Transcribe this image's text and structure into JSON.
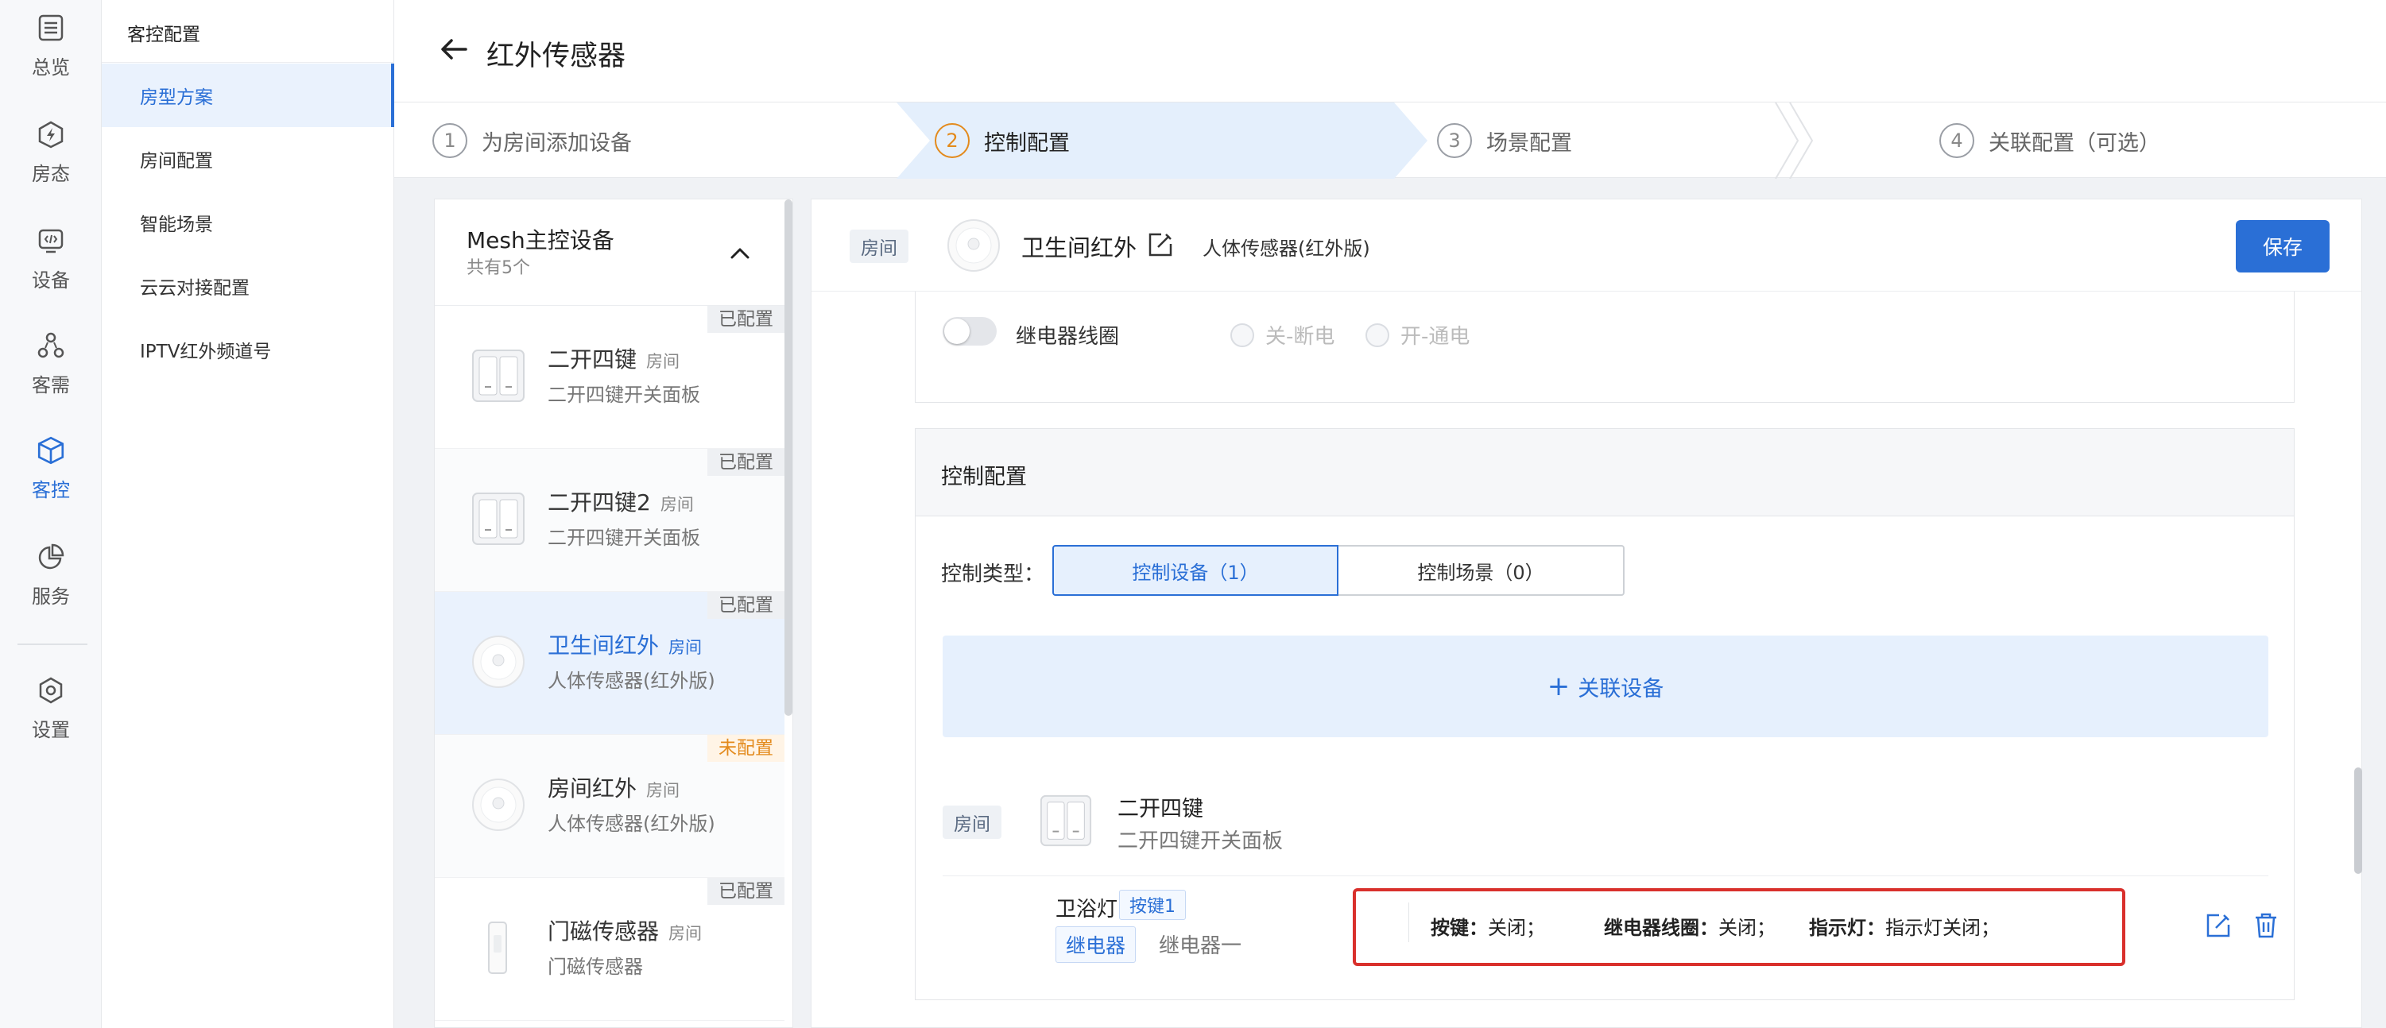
{
  "rail": {
    "items": [
      {
        "label": "总览",
        "icon": "overview-icon"
      },
      {
        "label": "房态",
        "icon": "room-status-icon"
      },
      {
        "label": "设备",
        "icon": "device-icon"
      },
      {
        "label": "客需",
        "icon": "guest-request-icon"
      },
      {
        "label": "客控",
        "icon": "guest-control-icon"
      },
      {
        "label": "服务",
        "icon": "service-icon"
      },
      {
        "label": "设置",
        "icon": "settings-icon"
      }
    ]
  },
  "subnav": {
    "title": "客控配置",
    "items": [
      {
        "label": "房型方案"
      },
      {
        "label": "房间配置"
      },
      {
        "label": "智能场景"
      },
      {
        "label": "云云对接配置"
      },
      {
        "label": "IPTV红外频道号"
      }
    ]
  },
  "header": {
    "title": "红外传感器"
  },
  "steps": [
    {
      "num": "1",
      "label": "为房间添加设备"
    },
    {
      "num": "2",
      "label": "控制配置"
    },
    {
      "num": "3",
      "label": "场景配置"
    },
    {
      "num": "4",
      "label": "关联配置（可选）"
    }
  ],
  "device_panel": {
    "title": "Mesh主控设备",
    "count": "共有5个",
    "devices": [
      {
        "name": "二开四键",
        "tag": "房间",
        "desc": "二开四键开关面板",
        "status": "已配置"
      },
      {
        "name": "二开四键2",
        "tag": "房间",
        "desc": "二开四键开关面板",
        "status": "已配置"
      },
      {
        "name": "卫生间红外",
        "tag": "房间",
        "desc": "人体传感器(红外版)",
        "status": "已配置"
      },
      {
        "name": "房间红外",
        "tag": "房间",
        "desc": "人体传感器(红外版)",
        "status": "未配置"
      },
      {
        "name": "门磁传感器",
        "tag": "房间",
        "desc": "门磁传感器",
        "status": "已配置"
      }
    ]
  },
  "main": {
    "room_chip": "房间",
    "device_name": "卫生间红外",
    "device_type": "人体传感器(红外版)",
    "save_label": "保存",
    "relay": {
      "label": "继电器线圈",
      "options": [
        "关-断电",
        "开-通电"
      ]
    },
    "control": {
      "title": "控制配置",
      "type_label": "控制类型：",
      "tab_devices": "控制设备（1）",
      "tab_scenes": "控制场景（0）",
      "add_label": "关联设备",
      "linked": {
        "room_chip": "房间",
        "name": "二开四键",
        "desc": "二开四键开关面板",
        "button_name": "卫浴灯",
        "key_tag": "按键1",
        "relay_tag": "继电器",
        "relay_name": "继电器一",
        "statuses": [
          {
            "k": "按键：",
            "v": "关闭；"
          },
          {
            "k": "继电器线圈：",
            "v": "关闭；"
          },
          {
            "k": "指示灯：",
            "v": "指示灯关闭；"
          }
        ]
      }
    }
  },
  "colors": {
    "accent": "#2a6fd6",
    "warning": "#e38a1c",
    "highlight": "#d9302c"
  }
}
